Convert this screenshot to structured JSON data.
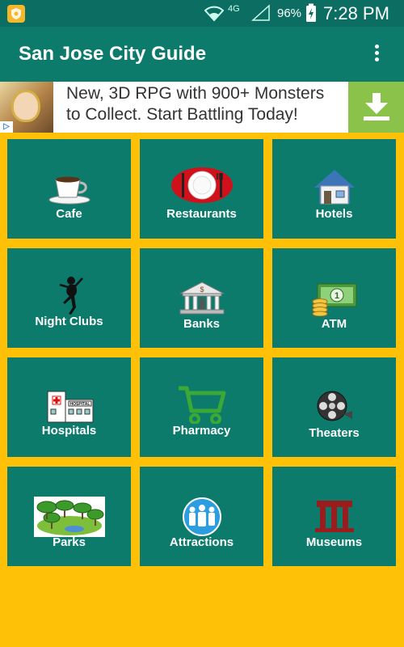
{
  "status_bar": {
    "network": "4G",
    "battery": "96%",
    "time": "7:28 PM"
  },
  "app_bar": {
    "title": "San Jose City Guide",
    "menu_icon": "more-vert-icon"
  },
  "ad": {
    "headline": "New, 3D RPG with 900+ Monsters to Collect. Start Battling Today!",
    "adchoices": "▷",
    "download_icon": "download-icon",
    "accent": "#8BC34A"
  },
  "categories": [
    {
      "label": "Cafe",
      "icon": "coffee-cup-icon"
    },
    {
      "label": "Restaurants",
      "icon": "plate-cutlery-icon"
    },
    {
      "label": "Hotels",
      "icon": "house-icon"
    },
    {
      "label": "Night Clubs",
      "icon": "dancer-icon"
    },
    {
      "label": "Banks",
      "icon": "bank-building-icon"
    },
    {
      "label": "ATM",
      "icon": "money-coins-icon"
    },
    {
      "label": "Hospitals",
      "icon": "hospital-building-icon"
    },
    {
      "label": "Pharmacy",
      "icon": "shopping-cart-icon"
    },
    {
      "label": "Theaters",
      "icon": "film-reel-icon"
    },
    {
      "label": "Parks",
      "icon": "park-trees-icon"
    },
    {
      "label": "Attractions",
      "icon": "people-group-icon"
    },
    {
      "label": "Museums",
      "icon": "museum-columns-icon"
    }
  ],
  "colors": {
    "background": "#FFC107",
    "tile": "#0C7B6C",
    "app_bar": "#0C7B6C",
    "status_bar": "#0C6E62"
  }
}
